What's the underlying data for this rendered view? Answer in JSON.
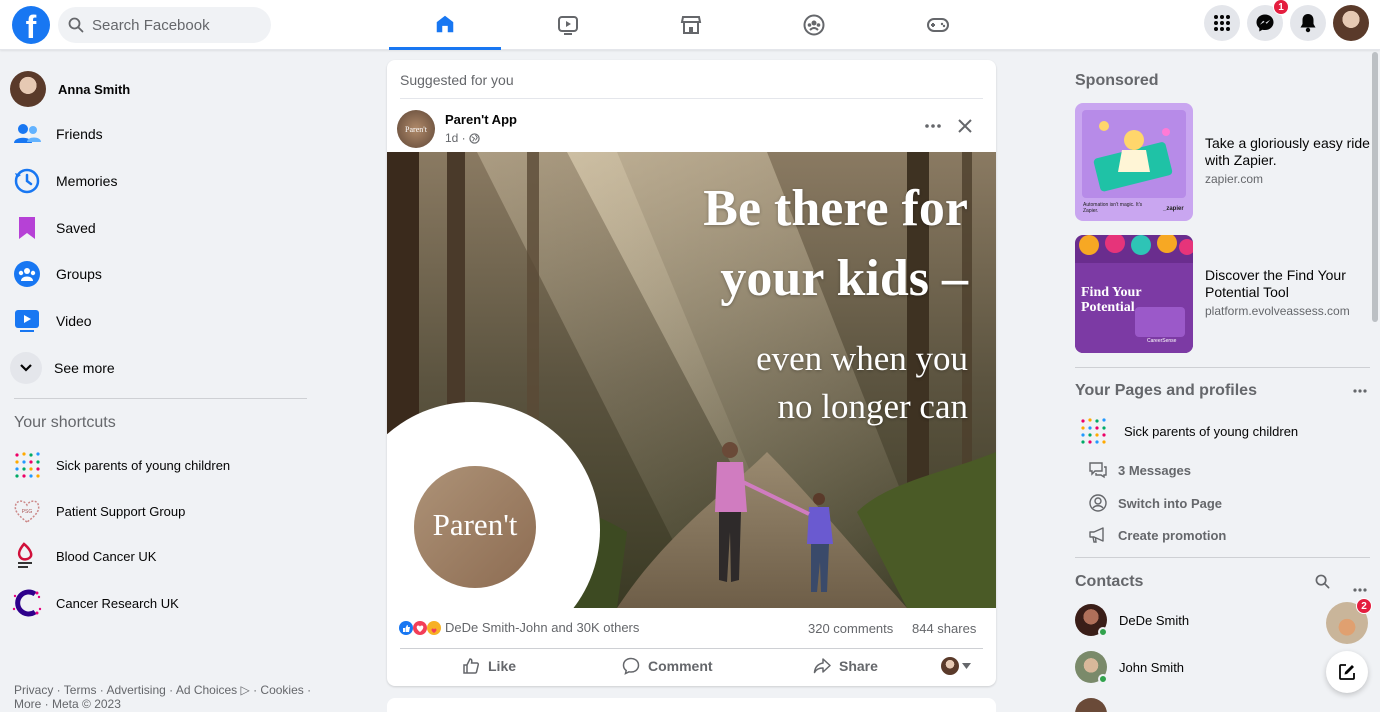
{
  "header": {
    "logo": "f",
    "search_placeholder": "Search Facebook",
    "messenger_badge": "1"
  },
  "colors": {
    "brand": "#1877f2",
    "badge": "#e41e3f",
    "online": "#31a24c"
  },
  "sidebar": {
    "user_name": "Anna Smith",
    "items": [
      {
        "label": "Friends",
        "icon": "friends-icon"
      },
      {
        "label": "Memories",
        "icon": "memories-icon"
      },
      {
        "label": "Saved",
        "icon": "saved-icon"
      },
      {
        "label": "Groups",
        "icon": "groups-icon"
      },
      {
        "label": "Video",
        "icon": "video-icon"
      },
      {
        "label": "See more",
        "icon": "chevron-down-icon"
      }
    ],
    "shortcuts_title": "Your shortcuts",
    "shortcuts": [
      {
        "label": "Sick parents of young children"
      },
      {
        "label": "Patient Support Group"
      },
      {
        "label": "Blood Cancer UK"
      },
      {
        "label": "Cancer Research UK"
      }
    ],
    "footer": "Privacy · Terms · Advertising · Ad Choices ▷ · Cookies · More · Meta © 2023"
  },
  "post": {
    "suggested_label": "Suggested for you",
    "author": "Paren't App",
    "author_avatar_text": "Paren't",
    "time": "1d ·",
    "headline_line1": "Be there for",
    "headline_line2": "your kids –",
    "sub_line1": "even when you",
    "sub_line2": "no longer can",
    "logo_text": "Paren't",
    "reactions_text": "DeDe Smith-John and 30K others",
    "comments": "320 comments",
    "shares": "844 shares",
    "like_label": "Like",
    "comment_label": "Comment",
    "share_label": "Share"
  },
  "right": {
    "sponsored_title": "Sponsored",
    "ads": [
      {
        "title": "Take a gloriously easy ride with Zapier.",
        "url": "zapier.com",
        "img_caption": "Automation isn't magic. It's Zapier.",
        "img_brand": "_zapier"
      },
      {
        "title": "Discover the Find Your Potential Tool",
        "url": "platform.evolveassess.com",
        "img_text": "Find Your Potential",
        "img_brand": "CareerSense"
      }
    ],
    "pages_title": "Your Pages and profiles",
    "page_name": "Sick parents of young children",
    "page_actions": [
      {
        "label": "3 Messages",
        "icon": "messages-icon"
      },
      {
        "label": "Switch into Page",
        "icon": "switch-profile-icon"
      },
      {
        "label": "Create promotion",
        "icon": "megaphone-icon"
      }
    ],
    "contacts_title": "Contacts",
    "contacts": [
      {
        "name": "DeDe Smith"
      },
      {
        "name": "John Smith"
      }
    ],
    "chat_badge": "2"
  }
}
